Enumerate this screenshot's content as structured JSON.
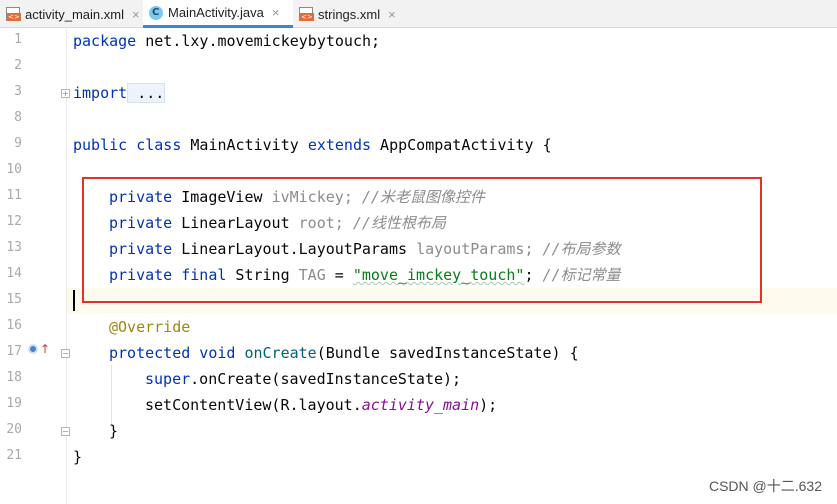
{
  "tabs": [
    {
      "label": "activity_main.xml",
      "icon": "xml-file-icon"
    },
    {
      "label": "MainActivity.java",
      "icon": "java-class-icon",
      "active": true
    },
    {
      "label": "strings.xml",
      "icon": "xml-file-icon"
    }
  ],
  "tab_close": "×",
  "line_numbers": [
    "1",
    "2",
    "3",
    "8",
    "9",
    "10",
    "11",
    "12",
    "13",
    "14",
    "15",
    "16",
    "17",
    "18",
    "19",
    "20",
    "21"
  ],
  "code": {
    "l1_kw": "package",
    "l1_rest": " net.lxy.movemickeybytouch;",
    "l3_kw": "import",
    "l3_rest": " ...",
    "l8_kw1": "public class",
    "l8_name": " MainActivity ",
    "l8_kw2": "extends",
    "l8_rest": " AppCompatActivity {",
    "l11_kw": "private",
    "l11_type": " ImageView ",
    "l11_field": "ivMickey",
    "l11_semi": "; ",
    "l11_comment": "//米老鼠图像控件",
    "l12_kw": "private",
    "l12_type": " LinearLayout ",
    "l12_field": "root",
    "l12_semi": "; ",
    "l12_comment": "//线性根布局",
    "l13_kw": "private",
    "l13_type": " LinearLayout.LayoutParams ",
    "l13_field": "layoutParams",
    "l13_semi": "; ",
    "l13_comment": "//布局参数",
    "l14_kw": "private final",
    "l14_type": " String ",
    "l14_field": "TAG",
    "l14_eq": " = ",
    "l14_str": "\"move_imckey_touch\"",
    "l14_semi": "; ",
    "l14_comment": "//标记常量",
    "l16_ann": "@Override",
    "l17_kw": "protected void",
    "l17_fn": " onCreate",
    "l17_rest": "(Bundle savedInstanceState) {",
    "l18_kw": "super",
    "l18_rest": ".onCreate(savedInstanceState);",
    "l19_pre": "setContentView(R.layout.",
    "l19_it": "activity_main",
    "l19_post": ");",
    "l20": "}",
    "l21": "}"
  },
  "watermark": "CSDN @十二.632",
  "colors": {
    "highlight_box": "#e2312c",
    "keyword": "#0033b3",
    "field": "#871094",
    "string": "#067d17",
    "comment": "#8c8c8c",
    "annotation": "#9e880d"
  }
}
